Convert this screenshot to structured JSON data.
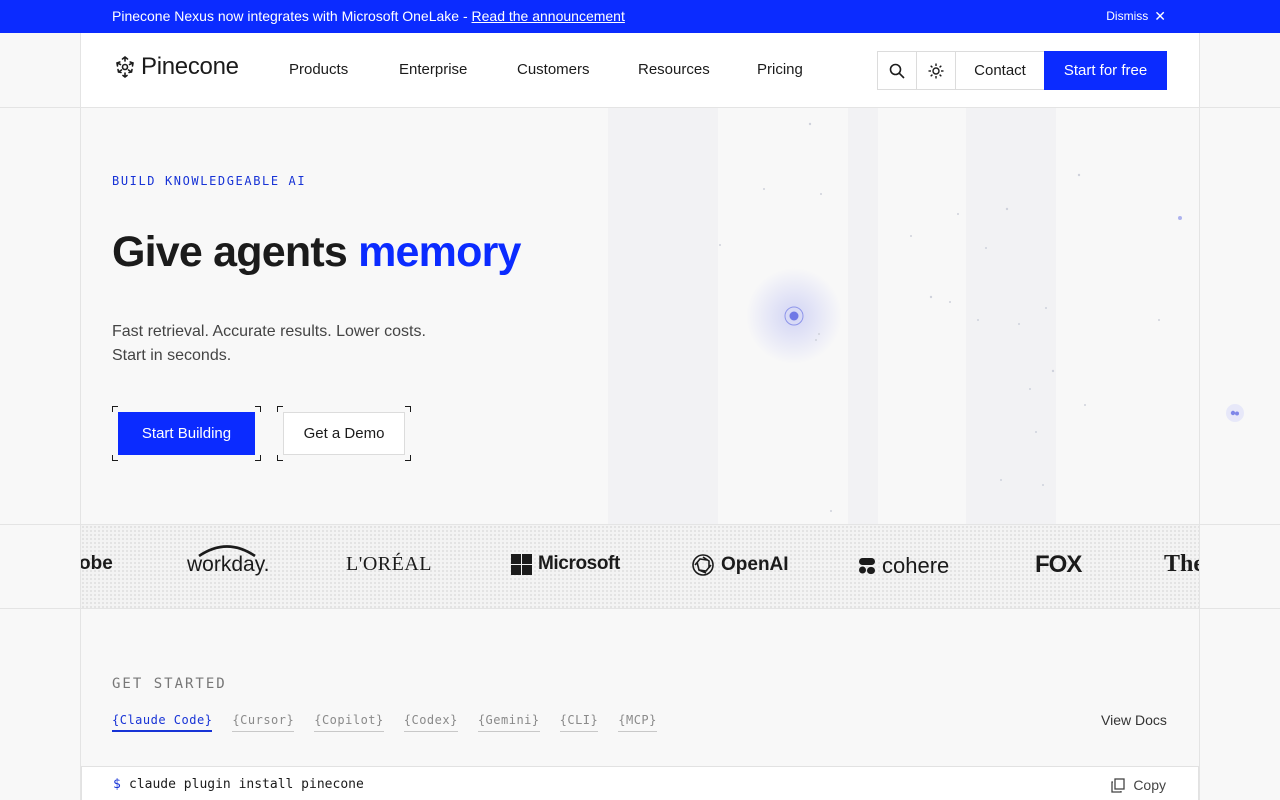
{
  "announcement": {
    "message": "Pinecone Nexus now integrates with Microsoft OneLake - ",
    "link": "Read the announcement",
    "dismiss": "Dismiss"
  },
  "header": {
    "logo": "Pinecone",
    "nav": [
      "Products",
      "Enterprise",
      "Customers",
      "Resources",
      "Pricing"
    ],
    "contact": "Contact",
    "start_free": "Start for free"
  },
  "hero": {
    "eyebrow": "BUILD KNOWLEDGEABLE AI",
    "headline_main": "Give agents ",
    "headline_accent": "memory",
    "sub_line1": "Fast retrieval. Accurate results. Lower costs.",
    "sub_line2": "Start in seconds.",
    "cta_primary": "Start Building",
    "cta_secondary": "Get a Demo"
  },
  "logos": [
    "obe",
    "workday.",
    "L'ORÉAL",
    "Microsoft",
    "OpenAI",
    "cohere",
    "FOX",
    "The"
  ],
  "get_started": {
    "label": "GET STARTED",
    "tabs": [
      "{Claude Code}",
      "{Cursor}",
      "{Copilot}",
      "{Codex}",
      "{Gemini}",
      "{CLI}",
      "{MCP}"
    ],
    "active_tab": 0,
    "view_docs": "View Docs",
    "prompt": "$",
    "command": "claude plugin install pinecone",
    "copy": "Copy"
  },
  "colors": {
    "brand_blue": "#0b2bff",
    "accent_text": "#1733d6"
  }
}
